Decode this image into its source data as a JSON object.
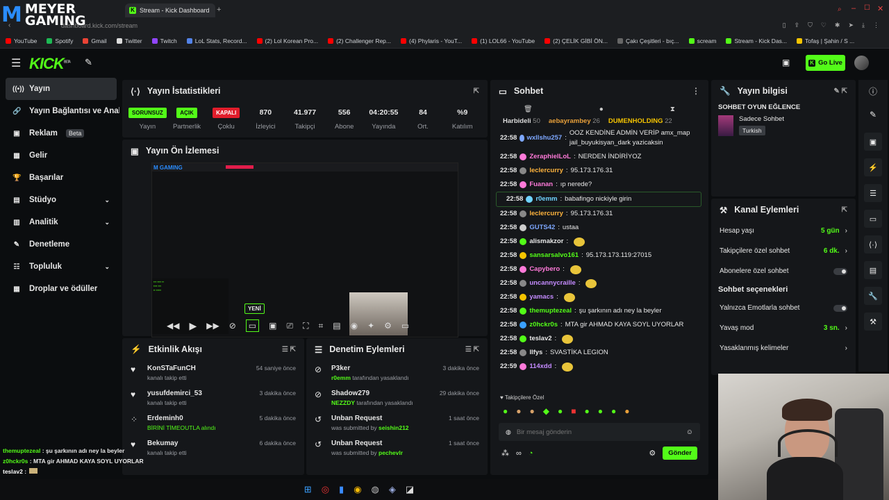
{
  "browser": {
    "tab_title": "Stream - Kick Dashboard",
    "url": "dashboard.kick.com/stream",
    "bookmarks": [
      {
        "label": "YouTube",
        "color": "#ff0000"
      },
      {
        "label": "Spotify",
        "color": "#1db954"
      },
      {
        "label": "Gmail",
        "color": "#ea4335"
      },
      {
        "label": "Twitter",
        "color": "#dddddd"
      },
      {
        "label": "Twitch",
        "color": "#9146ff"
      },
      {
        "label": "LoL Stats, Record...",
        "color": "#5383e8"
      },
      {
        "label": "(2) Lol Korean Pro...",
        "color": "#ff0000"
      },
      {
        "label": "(2) Challenger Rep...",
        "color": "#ff0000"
      },
      {
        "label": "(4) Phylaris - YouT...",
        "color": "#ff0000"
      },
      {
        "label": "(1) LOL66 - YouTube",
        "color": "#ff0000"
      },
      {
        "label": "(2) ÇELİK GİBİ ÖN...",
        "color": "#ff0000"
      },
      {
        "label": "Çakı Çeşitleri - bıç...",
        "color": "#666666"
      },
      {
        "label": "scream",
        "color": "#53fc18"
      },
      {
        "label": "Stream - Kick Das...",
        "color": "#53fc18"
      },
      {
        "label": "Tofaş | Şahin / S ...",
        "color": "#f5c400"
      }
    ]
  },
  "watermark": {
    "line1": "MEYER",
    "line2": "GAMING"
  },
  "topbar": {
    "logo": "KICK",
    "logo_sup": "BETA",
    "go_live": "Go Live"
  },
  "sidebar": {
    "items": [
      {
        "label": "Yayın",
        "icon": "broadcast-icon",
        "glyph": "((•))"
      },
      {
        "label": "Yayın Bağlantısı ve Anahtarı",
        "icon": "link-icon",
        "glyph": "🔗"
      },
      {
        "label": "Reklam",
        "icon": "ad-icon",
        "glyph": "▣",
        "beta": "Beta"
      },
      {
        "label": "Gelir",
        "icon": "revenue-icon",
        "glyph": "▦"
      },
      {
        "label": "Başarılar",
        "icon": "trophy-icon",
        "glyph": "🏆"
      },
      {
        "label": "Stüdyo",
        "icon": "studio-icon",
        "glyph": "▤",
        "chevron": true
      },
      {
        "label": "Analitik",
        "icon": "analytics-icon",
        "glyph": "▥",
        "chevron": true
      },
      {
        "label": "Denetleme",
        "icon": "hammer-icon",
        "glyph": "✎"
      },
      {
        "label": "Topluluk",
        "icon": "community-icon",
        "glyph": "☷",
        "chevron": true
      },
      {
        "label": "Droplar ve ödüller",
        "icon": "gift-icon",
        "glyph": "▦"
      }
    ]
  },
  "stats_panel": {
    "title": "Yayın İstatistikleri",
    "items": [
      {
        "value": "SORUNSUZ",
        "label": "Yayın",
        "kind": "green"
      },
      {
        "value": "AÇIK",
        "label": "Partnerlik",
        "kind": "green"
      },
      {
        "value": "KAPALI",
        "label": "Çoklu",
        "kind": "red"
      },
      {
        "value": "870",
        "label": "İzleyici"
      },
      {
        "value": "41.977",
        "label": "Takipçi"
      },
      {
        "value": "556",
        "label": "Abone"
      },
      {
        "value": "04:20:55",
        "label": "Yayında"
      },
      {
        "value": "84",
        "label": "Ort."
      },
      {
        "value": "%9",
        "label": "Katılım"
      }
    ]
  },
  "preview_panel": {
    "title": "Yayın Ön İzlemesi",
    "new_tooltip": "YENİ"
  },
  "activity_panel": {
    "title": "Etkinlik Akışı",
    "items": [
      {
        "name": "KonSTaFunCH",
        "sub": "kanalı takip etti",
        "time": "54 saniye önce",
        "icon": "heart-icon",
        "glyph": "♥"
      },
      {
        "name": "yusufdemirci_53",
        "sub": "kanalı takip etti",
        "time": "3 dakika önce",
        "icon": "heart-icon",
        "glyph": "♥"
      },
      {
        "name": "Erdeminh0",
        "sub": "BİRİNİ TİMEOUTLA alındı",
        "time": "5 dakika önce",
        "icon": "reward-icon",
        "glyph": "⁘"
      },
      {
        "name": "Bekumay",
        "sub": "kanalı takip etti",
        "time": "6 dakika önce",
        "icon": "heart-icon",
        "glyph": "♥"
      }
    ]
  },
  "moderation_panel": {
    "title": "Denetim Eylemleri",
    "items": [
      {
        "name": "P3ker",
        "user": "r0emm",
        "sub": "tarafından yasaklandı",
        "time": "3 dakika önce",
        "icon": "ban-icon",
        "glyph": "⊘"
      },
      {
        "name": "Shadow279",
        "user": "NEZZDY",
        "sub": "tarafından yasaklandı",
        "time": "29 dakika önce",
        "icon": "ban-icon",
        "glyph": "⊘"
      },
      {
        "name": "Unban Request",
        "user": "seishin212",
        "sub": "was submitted by",
        "time": "1 saat önce",
        "icon": "unban-icon",
        "glyph": "↺"
      },
      {
        "name": "Unban Request",
        "user": "pechevlr",
        "sub": "was submitted by",
        "time": "1 saat önce",
        "icon": "unban-icon",
        "glyph": "↺"
      }
    ]
  },
  "chat_panel": {
    "title": "Sohbet",
    "top_gifters": [
      {
        "name": "Harbideli",
        "count": "50"
      },
      {
        "name": "aebayrambey",
        "count": "26"
      },
      {
        "name": "DUMENHOLDING",
        "count": "22"
      }
    ],
    "messages": [
      {
        "time": "22:58",
        "user": "wxllshu257",
        "color": "#7da7ff",
        "text": "OOZ KENDİNE ADMİN VERİP amx_map jail_buyukisyan_dark yazicaksin"
      },
      {
        "time": "22:58",
        "user": "ZeraphielLoL",
        "color": "#ff7ad9",
        "text": "NERDEN İNDİRİYOZ"
      },
      {
        "time": "22:58",
        "user": "leclercurry",
        "color": "#ffb43d",
        "text": "95.173.176.31"
      },
      {
        "time": "22:58",
        "user": "Fuanan",
        "color": "#ff7ad9",
        "text": "ıp nerede?"
      },
      {
        "time": "22:58",
        "user": "r0emm",
        "color": "#6fd3ff",
        "text": "babafingo nickiyle girin"
      },
      {
        "time": "22:58",
        "user": "leclercurry",
        "color": "#ffb43d",
        "text": "95.173.176.31"
      },
      {
        "time": "22:58",
        "user": "GUTS42",
        "color": "#7da7ff",
        "text": "ustaa"
      },
      {
        "time": "22:58",
        "user": "alismakzor",
        "color": "#e8e8e8",
        "text": ""
      },
      {
        "time": "22:58",
        "user": "sansarsalvo161",
        "color": "#53fc18",
        "text": "95.173.173.119:27015"
      },
      {
        "time": "22:58",
        "user": "Capybero",
        "color": "#ff7ad9",
        "text": ""
      },
      {
        "time": "22:58",
        "user": "uncannycraille",
        "color": "#c48bff",
        "text": ""
      },
      {
        "time": "22:58",
        "user": "yamacs",
        "color": "#c48bff",
        "text": ""
      },
      {
        "time": "22:58",
        "user": "themuptezeal",
        "color": "#53fc18",
        "text": "şu şarkının adı ney la beyler"
      },
      {
        "time": "22:58",
        "user": "z0hckr0s",
        "color": "#53fc18",
        "text": "MTA gir AHMAD KAYA SOYL UYORLAR"
      },
      {
        "time": "22:58",
        "user": "teslav2",
        "color": "#e8e8e8",
        "text": ""
      },
      {
        "time": "22:58",
        "user": "llfys",
        "color": "#e8e8e8",
        "text": "SVASTİKA LEGION"
      },
      {
        "time": "22:59",
        "user": "114xdd",
        "color": "#c48bff",
        "text": ""
      }
    ],
    "followers_only": "Takipçilere Özel",
    "input_placeholder": "Bir mesaj gönderin",
    "send": "Gönder"
  },
  "stream_info": {
    "title": "Yayın bilgisi",
    "stream_title": "SOHBET OYUN EĞLENCE",
    "category": "Sadece Sohbet",
    "tag": "Turkish"
  },
  "channel_actions": {
    "title": "Kanal Eylemleri",
    "rows": [
      {
        "label": "Hesap yaşı",
        "value": "5 gün",
        "kind": "value"
      },
      {
        "label": "Takipçilere özel sohbet",
        "value": "6 dk.",
        "kind": "value"
      },
      {
        "label": "Abonelere özel sohbet",
        "kind": "toggle"
      }
    ],
    "chat_options_title": "Sohbet seçenekleri",
    "chat_rows": [
      {
        "label": "Yalnızca Emotlarla sohbet",
        "kind": "toggle"
      },
      {
        "label": "Yavaş mod",
        "value": "3 sn.",
        "kind": "value"
      },
      {
        "label": "Yasaklanmış kelimeler",
        "kind": "arrow"
      }
    ]
  },
  "overlay_chat": [
    {
      "user": "themuptezeal",
      "text": "şu şarkının adı ney la beyler",
      "color": "#53fc18"
    },
    {
      "user": "z0hckr0s",
      "text": "MTA gir AHMAD KAYA SOYL UYORLAR",
      "color": "#53fc18"
    },
    {
      "user": "teslav2",
      "text": "",
      "color": "#ffffff"
    },
    {
      "user": "llfys",
      "text": "SVASTİKA LEGION",
      "color": "#ffffff"
    },
    {
      "user": "114xdd",
      "text": "",
      "color": "#c48bff"
    }
  ]
}
